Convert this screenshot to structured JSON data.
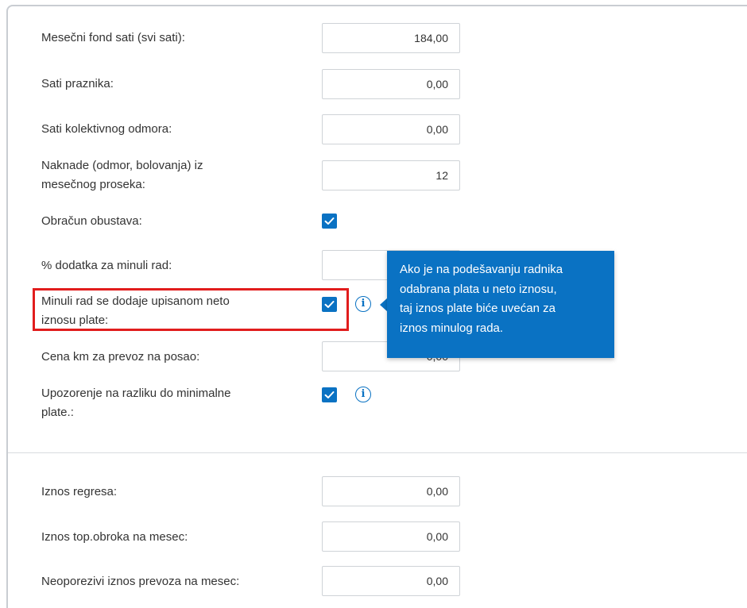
{
  "fields": [
    {
      "label": "Mesečni fond sati (svi sati):",
      "value": "184,00"
    },
    {
      "label": "Sati praznika:",
      "value": "0,00"
    },
    {
      "label": "Sati kolektivnog odmora:",
      "value": "0,00"
    },
    {
      "label_line1": "Naknade (odmor, bolovanja) iz",
      "label_line2": "mesečnog proseka:",
      "value": "12"
    },
    {
      "label": "Obračun obustava:",
      "checked": true
    },
    {
      "label": "% dodatka za minuli rad:",
      "value": ""
    },
    {
      "label_line1": "Minuli rad se dodaje upisanom neto",
      "label_line2": "iznosu plate:",
      "checked": true,
      "info_icon": "info-icon"
    },
    {
      "label": "Cena km za prevoz na posao:",
      "value": "0,00"
    },
    {
      "label_line1": "Upozorenje na razliku do minimalne",
      "label_line2": "plate.:",
      "checked": true,
      "info_icon": "info-icon"
    },
    {
      "label": "Iznos regresa:",
      "value": "0,00"
    },
    {
      "label": "Iznos top.obroka na mesec:",
      "value": "0,00"
    },
    {
      "label": "Neoporezivi iznos prevoza na mesec:",
      "value": "0,00"
    }
  ],
  "tooltip": {
    "line1": "Ako je na podešavanju radnika",
    "line2": "odabrana plata u neto iznosu,",
    "line3": "taj iznos plate biće uvećan za",
    "line4": "iznos minulog rada."
  },
  "colors": {
    "accent": "#0a72c3",
    "highlight": "#e11d1d"
  }
}
